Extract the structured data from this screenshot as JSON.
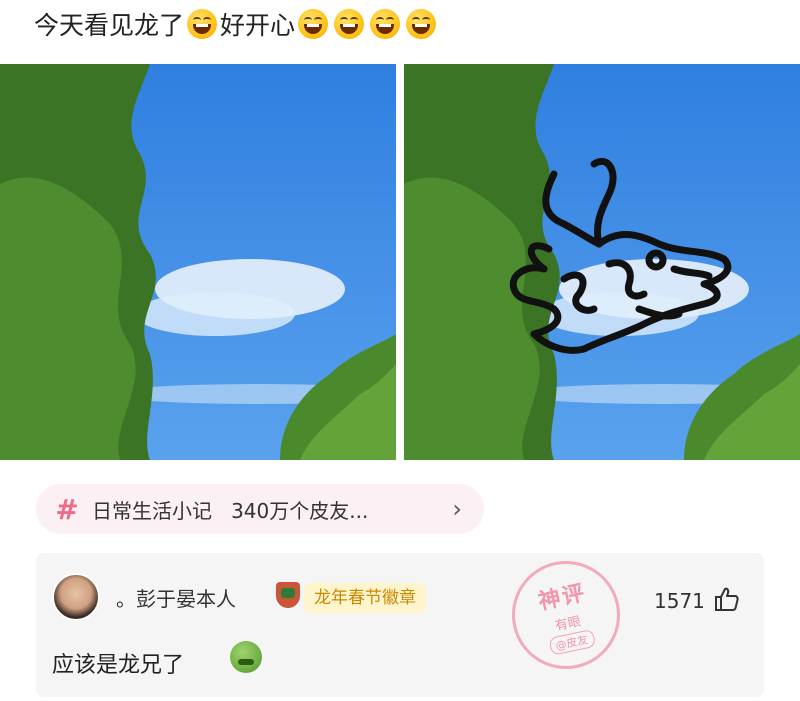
{
  "post": {
    "text_part1": "今天看见龙了",
    "text_part2": "好开心",
    "emoji": "grinning-squinting-face"
  },
  "images": [
    {
      "name": "cloud-photo",
      "description_icon": "photo"
    },
    {
      "name": "cloud-photo-with-dragon-drawing",
      "description_icon": "photo"
    }
  ],
  "topic": {
    "icon": "hash-icon",
    "label": "日常生活小记",
    "count": "340万个皮友...",
    "chevron": "›"
  },
  "comment": {
    "username": "。彭于晏本人",
    "badge": "龙年春节徽章",
    "text": "应该是龙兄了",
    "likes": "1571",
    "stamp": {
      "title": "神评",
      "subtitle": "有眼",
      "tag": "@皮友"
    }
  },
  "colors": {
    "sky": "#3d8be6",
    "tree": "#3f7d28",
    "accent_pink": "#f06a8a",
    "badge_gold": "#c98a00"
  }
}
